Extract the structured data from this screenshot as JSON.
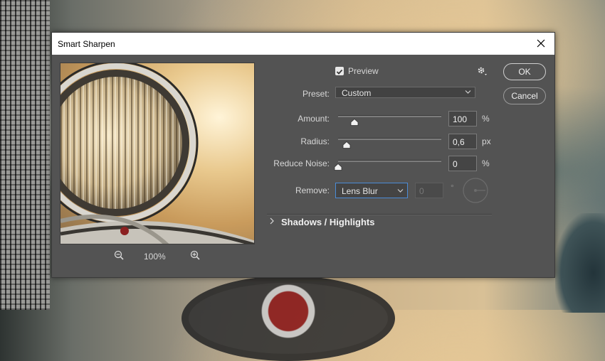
{
  "dialog": {
    "title": "Smart Sharpen",
    "close_icon": "close-icon"
  },
  "preview": {
    "checked": true,
    "label": "Preview",
    "zoom": "100%"
  },
  "buttons": {
    "ok": "OK",
    "cancel": "Cancel"
  },
  "preset": {
    "label": "Preset:",
    "value": "Custom"
  },
  "amount": {
    "label": "Amount:",
    "value": "100",
    "unit": "%",
    "slider_fraction": 0.16
  },
  "radius": {
    "label": "Radius:",
    "value": "0,6",
    "unit": "px",
    "slider_fraction": 0.08
  },
  "reduce_noise": {
    "label": "Reduce Noise:",
    "value": "0",
    "unit": "%",
    "slider_fraction": 0.0
  },
  "remove": {
    "label": "Remove:",
    "value": "Lens Blur",
    "angle_value": "0",
    "angle_symbol": "°"
  },
  "section": {
    "shadows_highlights": "Shadows / Highlights"
  },
  "colors": {
    "dialog_bg": "#535353",
    "focus_border": "#4b8bd6"
  }
}
